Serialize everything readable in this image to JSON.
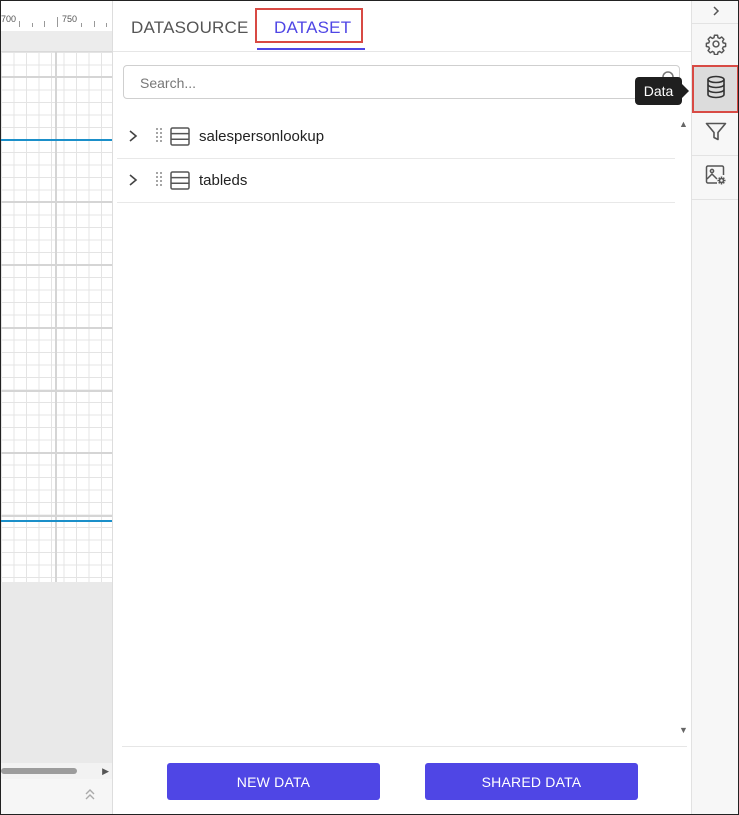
{
  "ruler": {
    "marks": [
      "700",
      "750"
    ]
  },
  "tabs": [
    {
      "label": "DATASOURCE",
      "active": false
    },
    {
      "label": "DATASET",
      "active": true
    }
  ],
  "search": {
    "placeholder": "Search...",
    "value": ""
  },
  "datasets": [
    {
      "label": "salespersonlookup"
    },
    {
      "label": "tableds"
    }
  ],
  "footer": {
    "new_data_label": "NEW DATA",
    "shared_data_label": "SHARED DATA"
  },
  "toolbar": {
    "items": [
      {
        "icon": "chevron-right-icon"
      },
      {
        "icon": "gear-icon"
      },
      {
        "icon": "database-icon",
        "active": true
      },
      {
        "icon": "filter-icon"
      },
      {
        "icon": "image-settings-icon"
      }
    ],
    "tooltip": "Data"
  },
  "colors": {
    "accent": "#4f46e5",
    "highlight": "#d84a44",
    "guide_line": "#1b8fc9"
  }
}
